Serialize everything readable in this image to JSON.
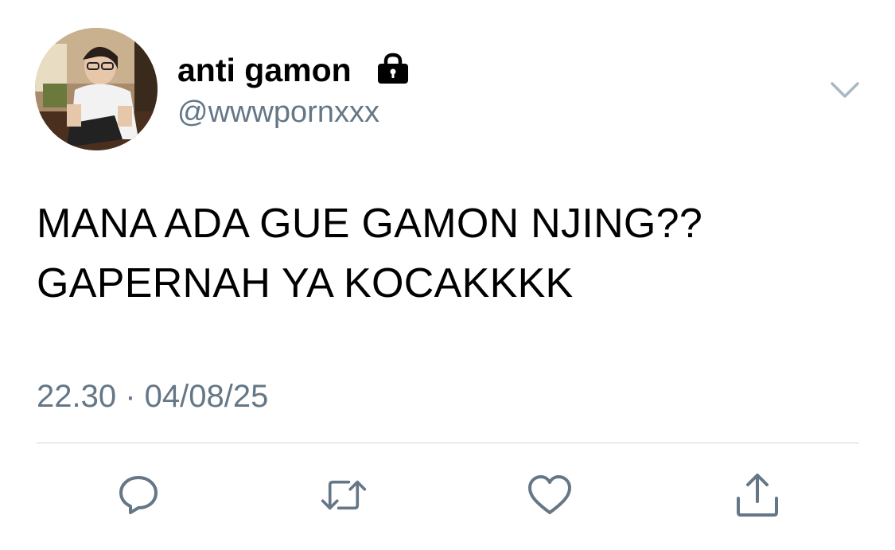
{
  "user": {
    "display_name": "anti gamon",
    "handle": "@wwwpornxxx",
    "avatar_icon": "profile-photo",
    "locked_icon": "lock-icon"
  },
  "tweet": {
    "text": "MANA ADA GUE GAMON NJING??\nGAPERNAH YA KOCAKKKK",
    "time": "22.30",
    "date": "04/08/25",
    "separator": " · "
  },
  "actions": [
    {
      "name": "reply",
      "icon": "comment-icon"
    },
    {
      "name": "retweet",
      "icon": "retweet-icon"
    },
    {
      "name": "like",
      "icon": "heart-icon"
    },
    {
      "name": "share",
      "icon": "share-icon"
    }
  ],
  "colors": {
    "secondary_text": "#657786",
    "icon": "#657786",
    "divider": "#d0d7dd"
  }
}
